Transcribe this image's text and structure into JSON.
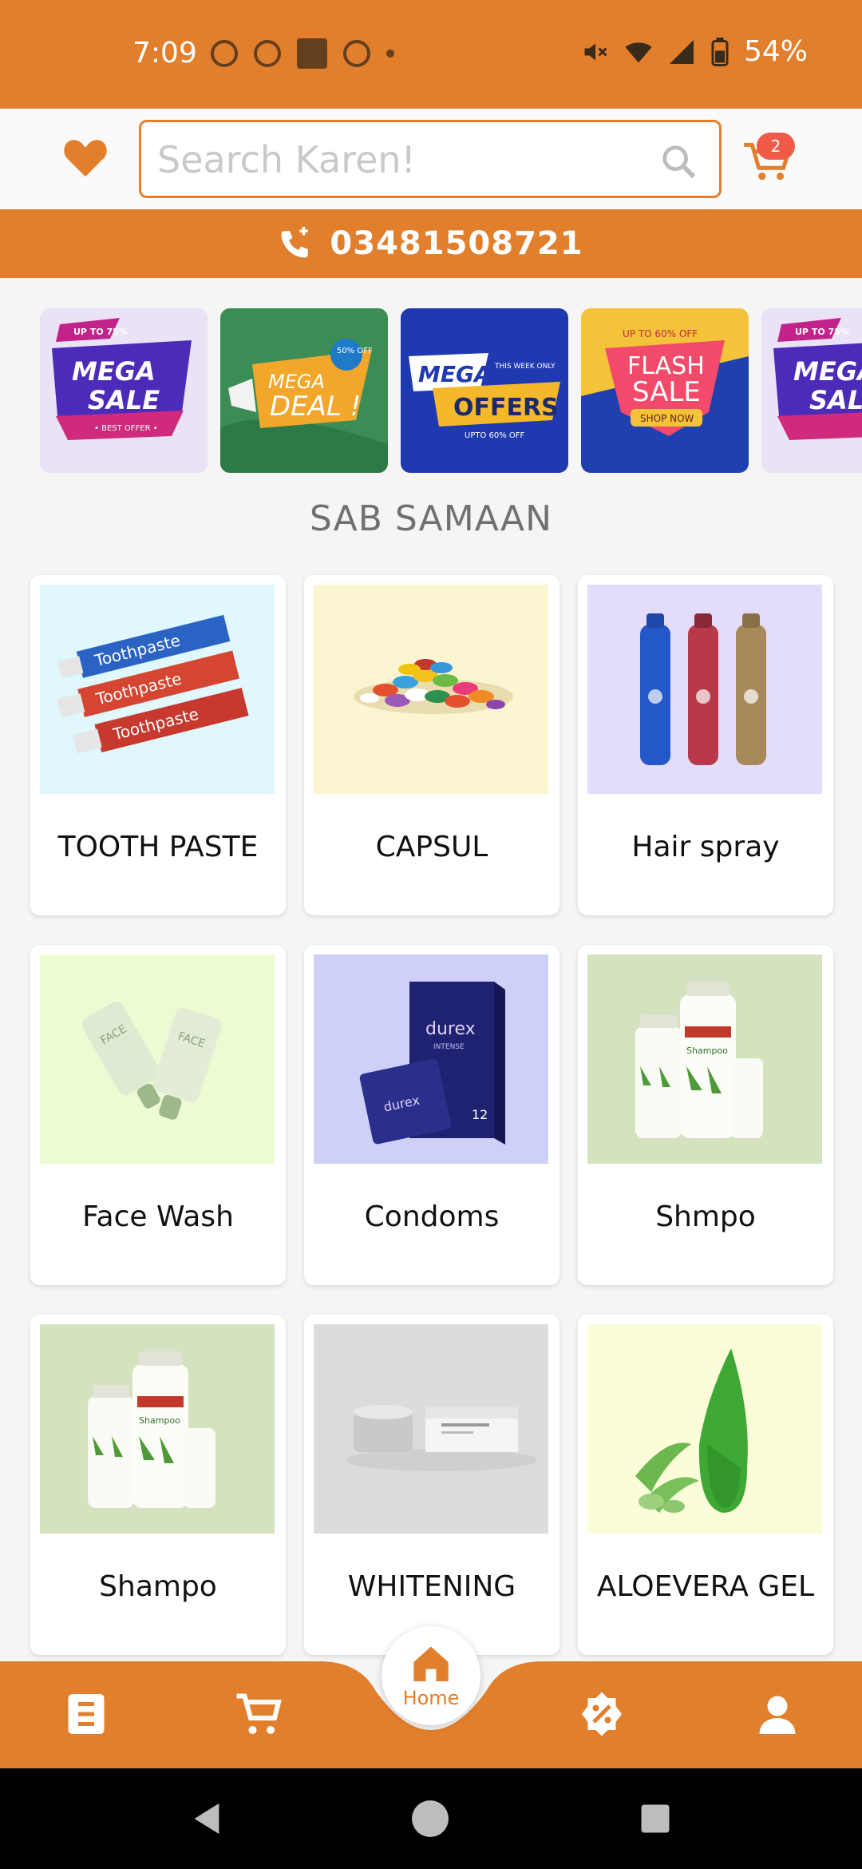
{
  "status_bar": {
    "time": "7:09",
    "battery": "54%"
  },
  "header": {
    "search_placeholder": "Search Karen!",
    "cart_count": "2"
  },
  "contact": {
    "phone": "03481508721"
  },
  "banners": [
    {
      "top": "UP TO 75%",
      "title1": "MEGA",
      "title2": "SALE",
      "bottom": "• BEST OFFER •"
    },
    {
      "badge": "50% OFF",
      "title1": "MEGA",
      "title2": "DEAL !"
    },
    {
      "title1": "MEGA",
      "side": "THIS WEEK ONLY",
      "title2": "OFFERS",
      "bottom": "UPTO 60% OFF"
    },
    {
      "top": "UP TO 60% OFF",
      "title1": "FLASH",
      "title2": "SALE",
      "bottom": "SHOP NOW"
    },
    {
      "top": "UP TO 75%",
      "title1": "MEGA",
      "title2": "SAL"
    }
  ],
  "section_title": "SAB SAMAAN",
  "products": [
    {
      "name": "TOOTH PASTE"
    },
    {
      "name": "CAPSUL"
    },
    {
      "name": "Hair spray"
    },
    {
      "name": "Face Wash"
    },
    {
      "name": "Condoms"
    },
    {
      "name": "Shmpo"
    },
    {
      "name": "Shampo"
    },
    {
      "name": "WHITENING"
    },
    {
      "name": "ALOEVERA GEL"
    }
  ],
  "product_art": {
    "toothpaste_label": "Toothpaste",
    "durex_brand": "durex",
    "durex_sub": "INTENSE",
    "durex_count": "12",
    "shampoo_label": "Shampoo",
    "facewash_label": "FACE"
  },
  "bottom_nav": {
    "home_label": "Home"
  },
  "colors": {
    "brand": "#e27f2d",
    "badge": "#f05a47",
    "background": "#f5f5f5"
  }
}
